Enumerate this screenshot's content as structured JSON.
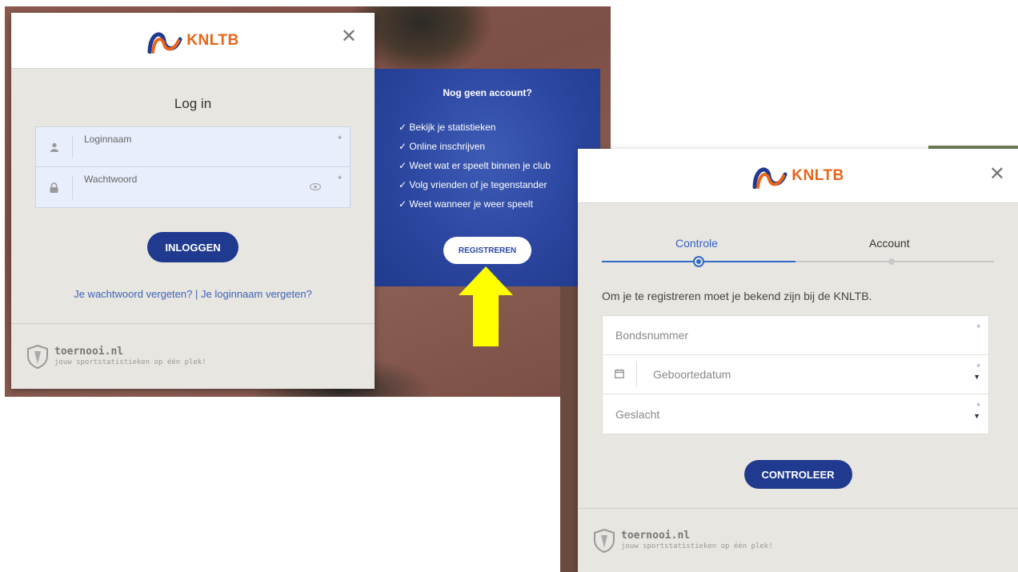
{
  "login": {
    "brand": "KNLTB",
    "close": "✕",
    "title": "Log in",
    "username_label": "Loginnaam",
    "password_label": "Wachtwoord",
    "required_mark": "*",
    "login_button": "INLOGGEN",
    "forgot_password": "Je wachtwoord vergeten?",
    "separator": "|",
    "forgot_username": "Je loginnaam vergeten?",
    "footer_brand": "toernooi.nl",
    "footer_tagline": "jouw sportstatistieken op één plek!"
  },
  "register_panel": {
    "title": "Nog geen account?",
    "benefits": [
      "Bekijk je statistieken",
      "Online inschrijven",
      "Weet wat er speelt binnen je club",
      "Volg vrienden of je tegenstander",
      "Weet wanneer je weer speelt"
    ],
    "register_button": "REGISTREREN"
  },
  "register": {
    "brand": "KNLTB",
    "close": "✕",
    "steps": [
      "Controle",
      "Account"
    ],
    "active_step": 0,
    "intro": "Om je te registreren moet je bekend zijn bij de KNLTB.",
    "fields": {
      "bondsnummer": "Bondsnummer",
      "geboortedatum": "Geboortedatum",
      "geslacht": "Geslacht"
    },
    "required_mark": "*",
    "check_button": "CONTROLEER",
    "footer_brand": "toernooi.nl",
    "footer_tagline": "jouw sportstatistieken op één plek!"
  },
  "colors": {
    "brand_blue": "#1f3a8e",
    "brand_orange": "#e8651a",
    "highlight_arrow": "#ffff00"
  }
}
